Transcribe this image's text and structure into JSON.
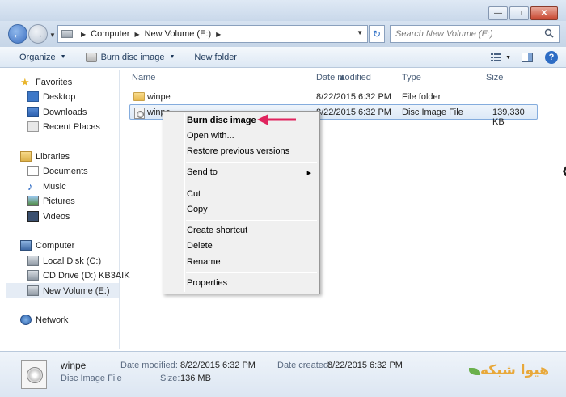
{
  "window": {
    "min_glyph": "—",
    "max_glyph": "□",
    "close_glyph": "✕"
  },
  "address": {
    "crumbs": [
      "Computer",
      "New Volume (E:)"
    ],
    "search_placeholder": "Search New Volume (E:)"
  },
  "toolbar": {
    "organize": "Organize",
    "burn": "Burn disc image",
    "new_folder": "New folder"
  },
  "sidebar": {
    "favorites": "Favorites",
    "desktop": "Desktop",
    "downloads": "Downloads",
    "recent_places": "Recent Places",
    "libraries": "Libraries",
    "documents": "Documents",
    "music": "Music",
    "pictures": "Pictures",
    "videos": "Videos",
    "computer": "Computer",
    "local_disk": "Local Disk (C:)",
    "cd_drive": "CD Drive (D:) KB3AIK",
    "new_volume": "New Volume (E:)",
    "network": "Network"
  },
  "columns": {
    "name": "Name",
    "date": "Date modified",
    "type": "Type",
    "size": "Size"
  },
  "files": [
    {
      "name": "winpe",
      "date": "8/22/2015 6:32 PM",
      "type": "File folder",
      "size": ""
    },
    {
      "name": "winpe",
      "date": "8/22/2015 6:32 PM",
      "type": "Disc Image File",
      "size": "139,330 KB"
    }
  ],
  "context_menu": {
    "burn": "Burn disc image",
    "open_with": "Open with...",
    "restore": "Restore previous versions",
    "send_to": "Send to",
    "cut": "Cut",
    "copy": "Copy",
    "create_shortcut": "Create shortcut",
    "delete": "Delete",
    "rename": "Rename",
    "properties": "Properties"
  },
  "details": {
    "name": "winpe",
    "type": "Disc Image File",
    "date_modified_label": "Date modified:",
    "date_modified": "8/22/2015 6:32 PM",
    "size_label": "Size:",
    "size": "136 MB",
    "date_created_label": "Date created:",
    "date_created": "8/22/2015 6:32 PM"
  },
  "watermark": "هیوا شبکه",
  "colors": {
    "annotation_arrow": "#e0245e",
    "selection": "#dce9f7",
    "toolbar_text": "#1e395b"
  }
}
